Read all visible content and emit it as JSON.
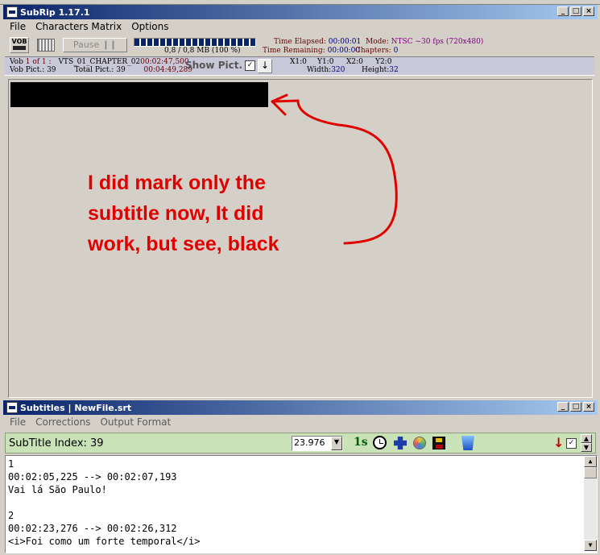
{
  "main_window": {
    "title": "SubRip 1.17.1",
    "menu": [
      "File",
      "Characters Matrix",
      "Options"
    ],
    "toolbar": {
      "vob_label": "VOB",
      "pause_label": "Pause ❙❙",
      "progress_text": "0,8 / 0,8 MB (100 %)",
      "progress_fraction": 1.0,
      "time_elapsed_label": "Time Elapsed:",
      "time_elapsed_value": "00:00:01",
      "time_remaining_label": "Time Remaining:",
      "time_remaining_value": "00:00:00",
      "mode_label": "Mode:",
      "mode_value": "NTSC ~30 fps (720x480)",
      "chapters_label": "Chapters:",
      "chapters_value": "0"
    },
    "info": {
      "vob_label": "Vob",
      "vob_value": "1 of 1 :",
      "vts_value": "VTS_01_CHAPTER_02",
      "time1": "00:02:47,500",
      "vob_pict_label": "Vob Pict.:",
      "vob_pict_value": "39",
      "total_pict_label": "Total Pict.:",
      "total_pict_value": "39",
      "time2": "00:04:49,289",
      "show_pict_label": "Show Pict.",
      "x1_label": "X1:",
      "x1_value": "0",
      "y1_label": "Y1:",
      "y1_value": "0",
      "x2_label": "X2:",
      "x2_value": "0",
      "y2_label": "Y2:",
      "y2_value": "0",
      "width_label": "Width:",
      "width_value": "320",
      "height_label": "Height:",
      "height_value": "32"
    },
    "annotation": {
      "line1": "I did mark only the",
      "line2": "subtitle now, It did",
      "line3": "work, but see, black"
    }
  },
  "subtitles_window": {
    "title": "Subtitles | NewFile.srt",
    "menu": [
      "File",
      "Corrections",
      "Output Format"
    ],
    "index_label": "SubTitle Index: 39",
    "fps_value": "23.976",
    "lines": [
      "1",
      "00:02:05,225 --> 00:02:07,193",
      "Vai lá São Paulo!",
      "",
      "2",
      "00:02:23,276 --> 00:02:26,312",
      "<i>Foi como um forte temporal</i>"
    ]
  },
  "colors": {
    "titlebar_start": "#0a246a",
    "titlebar_end": "#a6caf0",
    "annotation_red": "#e00000",
    "toolbar_green": "#c9e2b8"
  }
}
